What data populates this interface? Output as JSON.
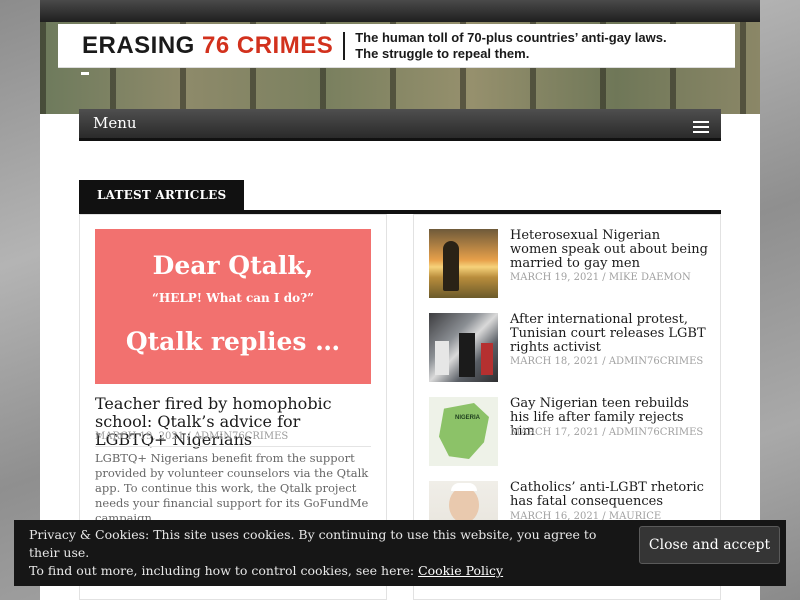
{
  "site": {
    "logo_part1": "ERASING",
    "logo_part2": "76 CRIMES",
    "tagline_line1": "The human toll of 70-plus countries’ anti-gay laws.",
    "tagline_line2": "The struggle to repeal them."
  },
  "nav": {
    "menu_label": "Menu",
    "menu_icon": "hamburger-icon"
  },
  "section": {
    "title": "LATEST ARTICLES"
  },
  "featured": {
    "image_line1": "Dear Qtalk,",
    "image_line2": "“HELP! What can I do?”",
    "image_line3": "Qtalk replies …",
    "title": "Teacher fired by homophobic school: Qtalk’s advice for LGBTQ+ Nigerians",
    "date": "MARCH 19, 2021",
    "author": "ADMIN76CRIMES",
    "excerpt": "LGBTQ+ Nigerians benefit from the support provided by volunteer counselors via the Qtalk app. To continue this work, the Qtalk project needs your financial support for its GoFundMe campaign."
  },
  "posts": [
    {
      "title": "Heterosexual Nigerian women speak out about being married to gay men",
      "date": "MARCH 19, 2021",
      "author": "MIKE DAEMON"
    },
    {
      "title": "After international protest, Tunisian court releases LGBT rights activist",
      "date": "MARCH 18, 2021",
      "author": "ADMIN76CRIMES"
    },
    {
      "title": "Gay Nigerian teen rebuilds his life after family rejects him",
      "date": "MARCH 17, 2021",
      "author": "ADMIN76CRIMES",
      "thumb_label": "NIGERIA"
    },
    {
      "title": "Catholics’ anti-LGBT rhetoric has fatal consequences",
      "date": "MARCH 16, 2021",
      "author": "MAURICE"
    }
  ],
  "cookie": {
    "text": "Privacy & Cookies: This site uses cookies. By continuing to use this website, you agree to their use.",
    "text2": "To find out more, including how to control cookies, see here:",
    "link": "Cookie Policy",
    "button": "Close and accept"
  },
  "colors": {
    "accent_red": "#d2311d",
    "featured_image_bg": "#f2716f",
    "nav_bg": "#2a2a2a"
  }
}
